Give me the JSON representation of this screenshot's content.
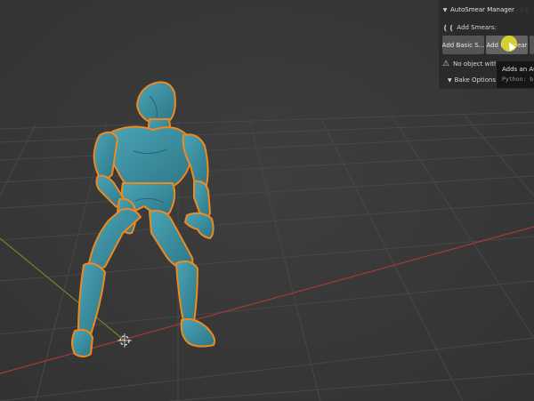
{
  "panel": {
    "title": "AutoSmear Manager",
    "add_label": "Add Smears:",
    "buttons": [
      "Add Basic S...",
      "Add F",
      "mear"
    ],
    "warning": "No object with",
    "bake_label": "Bake Options"
  },
  "tooltip": {
    "line1": "Adds an Au",
    "line2": "Python: b"
  },
  "icons": {
    "collapse": "chevron-down-icon",
    "smear": "smear-icon",
    "warning": "warning-icon",
    "cursor": "cursor-icon"
  },
  "colors": {
    "viewport_bg": "#3b3b3b",
    "grid": "#474747",
    "axis_x": "#a23a3a",
    "axis_y": "#6a8a2a",
    "mesh": "#3d8a9c",
    "selection_outline": "#f08a1e",
    "highlight": "#e6e428"
  }
}
